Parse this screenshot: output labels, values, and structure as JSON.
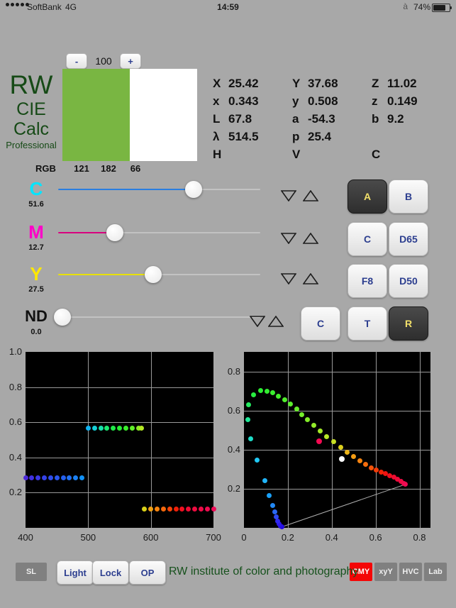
{
  "statusbar": {
    "carrier": "SoftBank",
    "network": "4G",
    "time": "14:59",
    "bluetooth_icon": "bluetooth-icon",
    "battery_percent": "74%"
  },
  "stepper": {
    "minus_label": "-",
    "plus_label": "+",
    "value": "100"
  },
  "logo": {
    "line1": "RW",
    "line2": "CIE",
    "line3": "Calc",
    "line4": "Professional",
    "color": "#164a16"
  },
  "swatch": {
    "left_color": "#79b642",
    "right_color": "#ffffff",
    "rgb_label": "RGB",
    "r": "121",
    "g": "182",
    "b": "66"
  },
  "readouts": {
    "rows": [
      [
        {
          "key": "X",
          "value": "25.42"
        },
        {
          "key": "Y",
          "value": "37.68"
        },
        {
          "key": "Z",
          "value": "11.02"
        }
      ],
      [
        {
          "key": "x",
          "value": "0.343"
        },
        {
          "key": "y",
          "value": "0.508"
        },
        {
          "key": "z",
          "value": "0.149"
        }
      ],
      [
        {
          "key": "L",
          "value": "67.8"
        },
        {
          "key": "a",
          "value": "-54.3"
        },
        {
          "key": "b",
          "value": "9.2"
        }
      ],
      [
        {
          "key": "λ",
          "value": "514.5"
        },
        {
          "key": "p",
          "value": "25.4"
        },
        {
          "key": "",
          "value": ""
        }
      ],
      [
        {
          "key": "H",
          "value": ""
        },
        {
          "key": "V",
          "value": ""
        },
        {
          "key": "C",
          "value": ""
        }
      ]
    ]
  },
  "sliders": [
    {
      "name": "cyan",
      "label": "C",
      "value": "51.6",
      "label_color": "#00e5ff",
      "track_color": "#2a7ee0",
      "percent": 67
    },
    {
      "name": "magenta",
      "label": "M",
      "value": "12.7",
      "label_color": "#ff00c8",
      "track_color": "#d8007f",
      "percent": 28
    },
    {
      "name": "yellow",
      "label": "Y",
      "value": "27.5",
      "label_color": "#ffe800",
      "track_color": "#e8e000",
      "percent": 47
    },
    {
      "name": "nd",
      "label": "ND",
      "value": "0.0",
      "label_color": "#111111",
      "track_color": "#bdbdbd",
      "percent": 2
    }
  ],
  "illuminants": [
    {
      "label": "A",
      "selected": true
    },
    {
      "label": "B",
      "selected": false
    },
    {
      "label": "C",
      "selected": false
    },
    {
      "label": "D65",
      "selected": false
    },
    {
      "label": "F8",
      "selected": false
    },
    {
      "label": "D50",
      "selected": false
    }
  ],
  "mode_buttons": [
    {
      "label": "C",
      "selected": false
    },
    {
      "label": "T",
      "selected": false
    },
    {
      "label": "R",
      "selected": true
    }
  ],
  "bottom_bar": {
    "left_buttons": [
      {
        "label": "SL",
        "style": "flat"
      },
      {
        "label": "Light",
        "style": "raised"
      },
      {
        "label": "Lock",
        "style": "raised"
      },
      {
        "label": "OP",
        "style": "raised"
      }
    ],
    "brand": "RW institute of color and photography",
    "right_buttons": [
      {
        "label": "CMY",
        "style": "red"
      },
      {
        "label": "xyY",
        "style": "flat"
      },
      {
        "label": "HVC",
        "style": "flat"
      },
      {
        "label": "Lab",
        "style": "flat"
      }
    ]
  },
  "chart_data": [
    {
      "type": "scatter",
      "name": "spectral-transmittance",
      "title": "",
      "xlabel": "",
      "ylabel": "",
      "xlim": [
        400,
        700
      ],
      "ylim": [
        0.0,
        1.0
      ],
      "xticks": [
        "400",
        "500",
        "600",
        "700"
      ],
      "yticks": [
        "0.2",
        "0.4",
        "0.6",
        "0.8",
        "1.0"
      ],
      "grid": true,
      "background": "#000000",
      "points": [
        {
          "x": 400,
          "y": 0.285,
          "color": "#4b28d8"
        },
        {
          "x": 410,
          "y": 0.285,
          "color": "#4030e0"
        },
        {
          "x": 420,
          "y": 0.285,
          "color": "#3a38e6"
        },
        {
          "x": 430,
          "y": 0.285,
          "color": "#3442e8"
        },
        {
          "x": 440,
          "y": 0.285,
          "color": "#2f4cea"
        },
        {
          "x": 450,
          "y": 0.285,
          "color": "#2a56ec"
        },
        {
          "x": 460,
          "y": 0.285,
          "color": "#2560ee"
        },
        {
          "x": 470,
          "y": 0.285,
          "color": "#2070f0"
        },
        {
          "x": 480,
          "y": 0.285,
          "color": "#1b80f2"
        },
        {
          "x": 490,
          "y": 0.285,
          "color": "#1090f6"
        },
        {
          "x": 500,
          "y": 0.565,
          "color": "#10b4f2"
        },
        {
          "x": 510,
          "y": 0.565,
          "color": "#14d0d8"
        },
        {
          "x": 520,
          "y": 0.565,
          "color": "#18e0a8"
        },
        {
          "x": 530,
          "y": 0.565,
          "color": "#1ce870"
        },
        {
          "x": 540,
          "y": 0.565,
          "color": "#20ea48"
        },
        {
          "x": 550,
          "y": 0.565,
          "color": "#28ec34"
        },
        {
          "x": 560,
          "y": 0.565,
          "color": "#3aee2c"
        },
        {
          "x": 570,
          "y": 0.565,
          "color": "#60ee28"
        },
        {
          "x": 580,
          "y": 0.565,
          "color": "#8cec26"
        },
        {
          "x": 585,
          "y": 0.565,
          "color": "#b4e824"
        },
        {
          "x": 590,
          "y": 0.105,
          "color": "#d8d018"
        },
        {
          "x": 600,
          "y": 0.105,
          "color": "#f0a014"
        },
        {
          "x": 610,
          "y": 0.105,
          "color": "#f68410"
        },
        {
          "x": 620,
          "y": 0.105,
          "color": "#f4680c"
        },
        {
          "x": 630,
          "y": 0.105,
          "color": "#f24408"
        },
        {
          "x": 640,
          "y": 0.105,
          "color": "#f02008"
        },
        {
          "x": 650,
          "y": 0.105,
          "color": "#f01020"
        },
        {
          "x": 660,
          "y": 0.105,
          "color": "#ee0c34"
        },
        {
          "x": 670,
          "y": 0.105,
          "color": "#ee0c40"
        },
        {
          "x": 680,
          "y": 0.105,
          "color": "#ee0c48"
        },
        {
          "x": 690,
          "y": 0.105,
          "color": "#ee0c50"
        },
        {
          "x": 700,
          "y": 0.105,
          "color": "#f00c58"
        }
      ]
    },
    {
      "type": "scatter",
      "name": "cie-chromaticity-diagram",
      "title": "",
      "xlabel": "",
      "ylabel": "",
      "xlim": [
        0.0,
        0.85
      ],
      "ylim": [
        0.0,
        0.9
      ],
      "xticks": [
        "0",
        "0.2",
        "0.4",
        "0.6",
        "0.8"
      ],
      "yticks": [
        "0.2",
        "0.4",
        "0.6",
        "0.8"
      ],
      "grid": true,
      "background": "#000000",
      "locus": [
        {
          "x": 0.173,
          "y": 0.005,
          "color": "#2008e0"
        },
        {
          "x": 0.166,
          "y": 0.01,
          "color": "#2810e4"
        },
        {
          "x": 0.16,
          "y": 0.02,
          "color": "#2c18e8"
        },
        {
          "x": 0.155,
          "y": 0.035,
          "color": "#3028ee"
        },
        {
          "x": 0.148,
          "y": 0.055,
          "color": "#2f48f0"
        },
        {
          "x": 0.14,
          "y": 0.08,
          "color": "#2a68f2"
        },
        {
          "x": 0.13,
          "y": 0.115,
          "color": "#2288f4"
        },
        {
          "x": 0.115,
          "y": 0.165,
          "color": "#1aa0f8"
        },
        {
          "x": 0.095,
          "y": 0.24,
          "color": "#20b4f8"
        },
        {
          "x": 0.06,
          "y": 0.345,
          "color": "#20c8f4"
        },
        {
          "x": 0.032,
          "y": 0.455,
          "color": "#1edcc8"
        },
        {
          "x": 0.018,
          "y": 0.555,
          "color": "#20e898"
        },
        {
          "x": 0.022,
          "y": 0.63,
          "color": "#24ea60"
        },
        {
          "x": 0.045,
          "y": 0.68,
          "color": "#28ec40"
        },
        {
          "x": 0.075,
          "y": 0.702,
          "color": "#2cee34"
        },
        {
          "x": 0.105,
          "y": 0.7,
          "color": "#32ee30"
        },
        {
          "x": 0.13,
          "y": 0.69,
          "color": "#3aee2e"
        },
        {
          "x": 0.157,
          "y": 0.675,
          "color": "#44ee2c"
        },
        {
          "x": 0.185,
          "y": 0.655,
          "color": "#50ee2c"
        },
        {
          "x": 0.213,
          "y": 0.632,
          "color": "#5cee2c"
        },
        {
          "x": 0.24,
          "y": 0.608,
          "color": "#68ee2c"
        },
        {
          "x": 0.265,
          "y": 0.58,
          "color": "#76ee2c"
        },
        {
          "x": 0.29,
          "y": 0.552,
          "color": "#84ec2a"
        },
        {
          "x": 0.318,
          "y": 0.523,
          "color": "#94ec2a"
        },
        {
          "x": 0.348,
          "y": 0.495,
          "color": "#a4ea28"
        },
        {
          "x": 0.378,
          "y": 0.468,
          "color": "#b6e826"
        },
        {
          "x": 0.408,
          "y": 0.44,
          "color": "#c8e024"
        },
        {
          "x": 0.44,
          "y": 0.412,
          "color": "#dcd01e"
        },
        {
          "x": 0.47,
          "y": 0.388,
          "color": "#ecb418"
        },
        {
          "x": 0.5,
          "y": 0.363,
          "color": "#f49c14"
        },
        {
          "x": 0.528,
          "y": 0.342,
          "color": "#f68410"
        },
        {
          "x": 0.555,
          "y": 0.323,
          "color": "#f66c0c"
        },
        {
          "x": 0.58,
          "y": 0.308,
          "color": "#f4540a"
        },
        {
          "x": 0.603,
          "y": 0.296,
          "color": "#f23c08"
        },
        {
          "x": 0.625,
          "y": 0.286,
          "color": "#f02408"
        },
        {
          "x": 0.645,
          "y": 0.277,
          "color": "#f01410"
        },
        {
          "x": 0.665,
          "y": 0.268,
          "color": "#f01020"
        },
        {
          "x": 0.685,
          "y": 0.258,
          "color": "#ee0c30"
        },
        {
          "x": 0.7,
          "y": 0.248,
          "color": "#ee0c3a"
        },
        {
          "x": 0.715,
          "y": 0.238,
          "color": "#ee0c44"
        },
        {
          "x": 0.728,
          "y": 0.228,
          "color": "#ee0c4c"
        },
        {
          "x": 0.735,
          "y": 0.222,
          "color": "#ee0c54"
        }
      ],
      "markers": [
        {
          "name": "sample-point",
          "x": 0.343,
          "y": 0.443,
          "color": "#f40a52"
        },
        {
          "name": "white-point",
          "x": 0.447,
          "y": 0.352,
          "color": "#ffffff"
        }
      ],
      "purple_line": {
        "from": {
          "x": 0.173,
          "y": 0.005
        },
        "to": {
          "x": 0.735,
          "y": 0.222
        },
        "color": "#b0b0b0"
      }
    }
  ]
}
